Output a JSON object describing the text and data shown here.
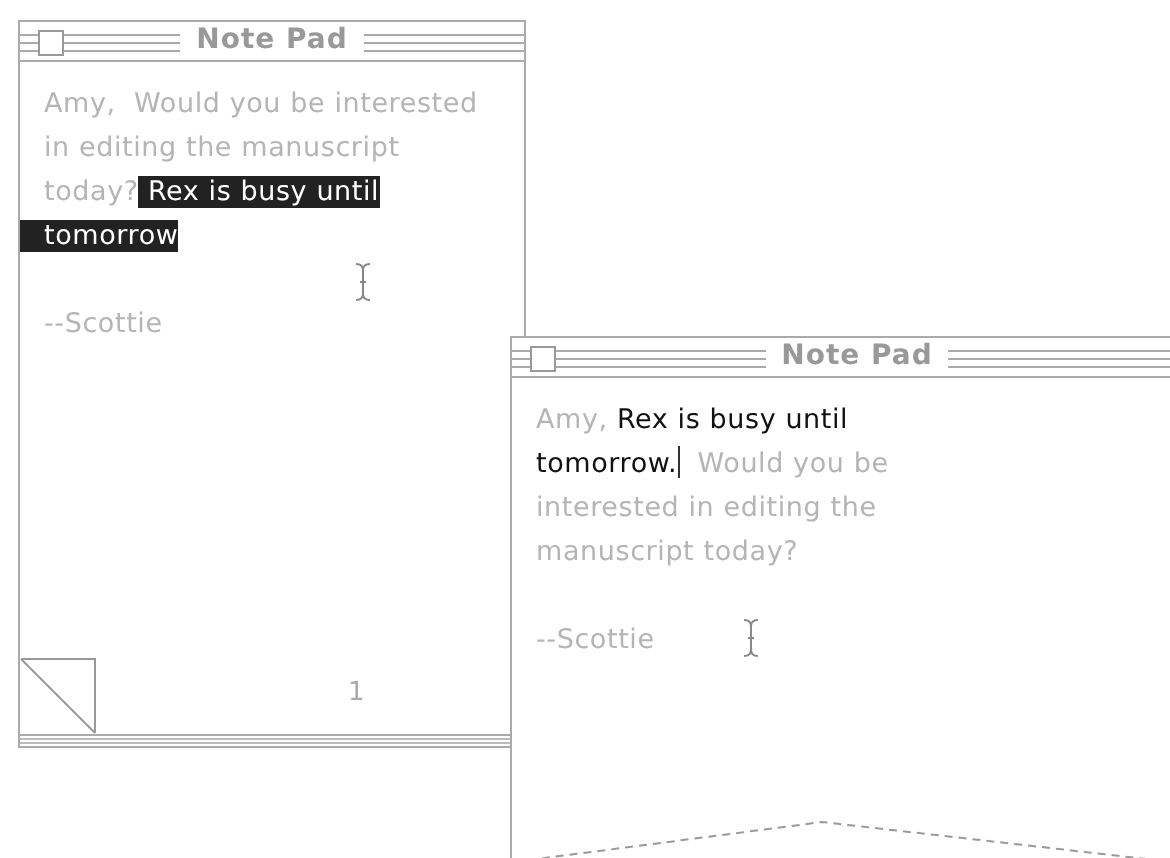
{
  "windows": [
    {
      "title": "Note Pad",
      "lines": [
        [
          {
            "kind": "dim",
            "text": "Amy,  Would you be interested"
          }
        ],
        [
          {
            "kind": "dim",
            "text": "in editing the manuscript"
          }
        ],
        [
          {
            "kind": "dim",
            "text": "today?"
          },
          {
            "kind": "selected",
            "text": " Rex is busy until"
          }
        ],
        [
          {
            "kind": "selected",
            "text": "tomorrow"
          }
        ]
      ],
      "signature": "--Scottie",
      "page_number": "1"
    },
    {
      "title": "Note Pad",
      "lines": [
        [
          {
            "kind": "dim",
            "text": "Amy,"
          },
          {
            "kind": "normal",
            "text": " Rex is busy until"
          }
        ],
        [
          {
            "kind": "normal",
            "text": "tomorrow."
          },
          {
            "kind": "caret"
          },
          {
            "kind": "dim",
            "text": "  Would you be"
          }
        ],
        [
          {
            "kind": "dim",
            "text": "interested in editing the"
          }
        ],
        [
          {
            "kind": "dim",
            "text": "manuscript today?"
          }
        ]
      ],
      "signature": "--Scottie"
    }
  ]
}
